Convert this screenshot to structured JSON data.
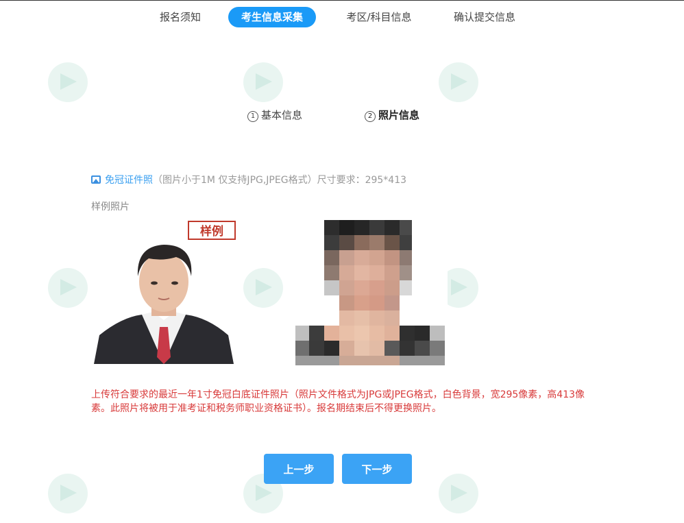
{
  "nav": {
    "steps": [
      {
        "label": "报名须知"
      },
      {
        "label": "考生信息采集"
      },
      {
        "label": "考区/科目信息"
      },
      {
        "label": "确认提交信息"
      }
    ]
  },
  "substeps": [
    {
      "num": "1",
      "label": "基本信息"
    },
    {
      "num": "2",
      "label": "照片信息"
    }
  ],
  "upload": {
    "link_label": "免冠证件照",
    "hint": "（图片小于1M   仅支持JPG,JPEG格式）尺寸要求：295*413"
  },
  "sample": {
    "section_label": "样例照片",
    "badge": "样例"
  },
  "requirement_text": "上传符合要求的最近一年1寸免冠白底证件照片（照片文件格式为JPG或JPEG格式，白色背景，宽295像素，高413像素。此照片将被用于准考证和税务师职业资格证书）。报名期结束后不得更换照片。",
  "buttons": {
    "prev": "上一步",
    "next": "下一步"
  },
  "colors": {
    "accent": "#1a9af7",
    "button": "#3ba3f5",
    "warning_text": "#d83a3a",
    "badge": "#c0392b"
  }
}
